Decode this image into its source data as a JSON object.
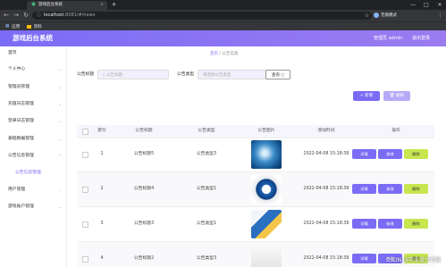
{
  "browser": {
    "tab_title": "游戏后台系统",
    "tab_close": "×",
    "new_tab": "+",
    "win_min": "—",
    "win_max": "□",
    "win_close": "✕",
    "url_host": "localhost",
    "url_rest": ":8081/#/news",
    "bookmarks": [
      "应用",
      "资料"
    ],
    "profile_label": "无痕模式",
    "nav_back": "←",
    "nav_forward": "→",
    "nav_reload": "↻",
    "lock": "ⓘ",
    "star": "☆",
    "menu": "⋮"
  },
  "header": {
    "title": "游戏后台系统",
    "admin_label": "管理员 admin",
    "logout_label": "退出登录"
  },
  "sidebar": {
    "items": [
      {
        "label": "首页"
      },
      {
        "label": "个人中心"
      },
      {
        "label": "管理员管理"
      },
      {
        "label": "充值日志管理"
      },
      {
        "label": "登录日志管理"
      },
      {
        "label": "基础数据管理"
      },
      {
        "label": "公告信息管理"
      },
      {
        "label": "用户管理"
      },
      {
        "label": "游戏账户管理"
      }
    ],
    "sub_item": "公告信息管理",
    "chevron": "⌄"
  },
  "main": {
    "breadcrumb_home": "首页",
    "breadcrumb_sep": "/",
    "breadcrumb_current": "公告信息",
    "filters": {
      "title_label": "公告标题",
      "title_placeholder": "公告标题",
      "type_label": "公告类型",
      "type_placeholder": "请选择公告类型",
      "search_label": "查询 ○"
    },
    "add_label": "+ 新增",
    "delete_label": "🗑 删除",
    "columns": [
      "",
      "索引",
      "公告标题",
      "公告类型",
      "公告图片",
      "添加时间",
      "操作"
    ],
    "rows": [
      {
        "index": "1",
        "title": "公告标题5",
        "type": "公告类型3",
        "time": "2022-04-08 15:18:39"
      },
      {
        "index": "2",
        "title": "公告标题4",
        "type": "公告类型1",
        "time": "2022-04-08 15:18:39"
      },
      {
        "index": "3",
        "title": "公告标题3",
        "type": "公告类型1",
        "time": "2022-04-08 15:18:39"
      },
      {
        "index": "4",
        "title": "公告标题2",
        "type": "公告类型3",
        "time": "2022-04-08 15:18:39"
      }
    ],
    "op_detail": "详情",
    "op_edit": "修改",
    "op_delete": "删除"
  },
  "watermark": "CSDN @毕业设计代做"
}
